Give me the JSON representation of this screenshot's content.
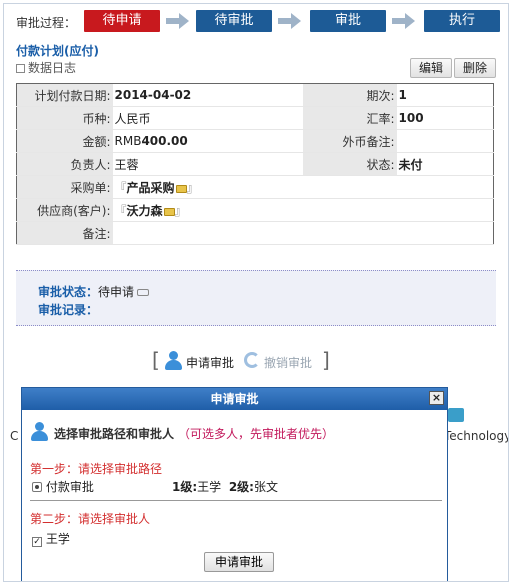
{
  "process": {
    "label": "审批过程：",
    "steps": [
      "待申请",
      "待审批",
      "审批",
      "执行"
    ]
  },
  "section_title": "付款计划(应付)",
  "data_log": "数据日志",
  "toolbar": {
    "edit": "编辑",
    "delete": "删除"
  },
  "info": {
    "plan_date_label": "计划付款日期:",
    "plan_date": "2014-04-02",
    "period_label": "期次:",
    "period": "1",
    "currency_label": "币种:",
    "currency": "人民币",
    "rate_label": "汇率:",
    "rate": "100",
    "amount_label": "金额:",
    "amount_prefix": "RMB",
    "amount": "400.00",
    "fx_note_label": "外币备注:",
    "fx_note": "",
    "owner_label": "负责人:",
    "owner": "王蓉",
    "status_label": "状态:",
    "status": "未付",
    "purchase_label": "采购单:",
    "purchase": "产品采购",
    "supplier_label": "供应商(客户):",
    "supplier": "沃力森",
    "remark_label": "备注:",
    "remark": ""
  },
  "approval": {
    "status_label": "审批状态：",
    "status": "待申请",
    "record_label": "审批记录："
  },
  "actions": {
    "apply": "申请审批",
    "revoke": "撤销审批"
  },
  "background": {
    "left_char": "C",
    "right_text": "Technology"
  },
  "dialog": {
    "title": "申请审批",
    "close": "×",
    "heading": "选择审批路径和审批人",
    "hint": "（可选多人，先审批者优先）",
    "step1": "第一步：请选择审批路径",
    "path": "付款审批",
    "level1_label": "1级:",
    "level1": "王学",
    "level2_label": "2级:",
    "level2": "张文",
    "step2": "第二步：请选择审批人",
    "approver": "王学",
    "submit": "申请审批"
  },
  "colors": {
    "active_step": "#c8191e",
    "step": "#1d5b96",
    "title_blue": "#1a5ea8",
    "hint": "#c2185b"
  }
}
